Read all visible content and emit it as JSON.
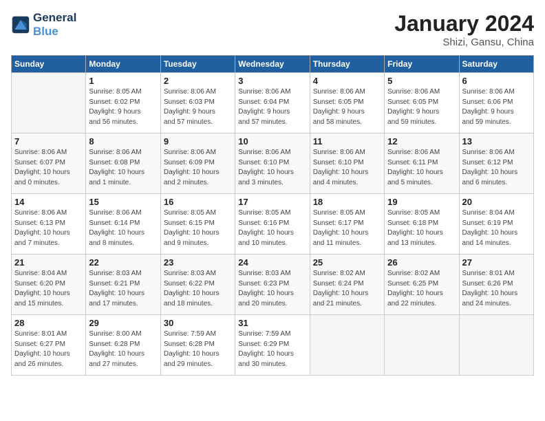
{
  "header": {
    "logo_general": "General",
    "logo_blue": "Blue",
    "month_title": "January 2024",
    "location": "Shizi, Gansu, China"
  },
  "weekdays": [
    "Sunday",
    "Monday",
    "Tuesday",
    "Wednesday",
    "Thursday",
    "Friday",
    "Saturday"
  ],
  "weeks": [
    [
      {
        "day": "",
        "info": ""
      },
      {
        "day": "1",
        "info": "Sunrise: 8:05 AM\nSunset: 6:02 PM\nDaylight: 9 hours\nand 56 minutes."
      },
      {
        "day": "2",
        "info": "Sunrise: 8:06 AM\nSunset: 6:03 PM\nDaylight: 9 hours\nand 57 minutes."
      },
      {
        "day": "3",
        "info": "Sunrise: 8:06 AM\nSunset: 6:04 PM\nDaylight: 9 hours\nand 57 minutes."
      },
      {
        "day": "4",
        "info": "Sunrise: 8:06 AM\nSunset: 6:05 PM\nDaylight: 9 hours\nand 58 minutes."
      },
      {
        "day": "5",
        "info": "Sunrise: 8:06 AM\nSunset: 6:05 PM\nDaylight: 9 hours\nand 59 minutes."
      },
      {
        "day": "6",
        "info": "Sunrise: 8:06 AM\nSunset: 6:06 PM\nDaylight: 9 hours\nand 59 minutes."
      }
    ],
    [
      {
        "day": "7",
        "info": "Sunrise: 8:06 AM\nSunset: 6:07 PM\nDaylight: 10 hours\nand 0 minutes."
      },
      {
        "day": "8",
        "info": "Sunrise: 8:06 AM\nSunset: 6:08 PM\nDaylight: 10 hours\nand 1 minute."
      },
      {
        "day": "9",
        "info": "Sunrise: 8:06 AM\nSunset: 6:09 PM\nDaylight: 10 hours\nand 2 minutes."
      },
      {
        "day": "10",
        "info": "Sunrise: 8:06 AM\nSunset: 6:10 PM\nDaylight: 10 hours\nand 3 minutes."
      },
      {
        "day": "11",
        "info": "Sunrise: 8:06 AM\nSunset: 6:10 PM\nDaylight: 10 hours\nand 4 minutes."
      },
      {
        "day": "12",
        "info": "Sunrise: 8:06 AM\nSunset: 6:11 PM\nDaylight: 10 hours\nand 5 minutes."
      },
      {
        "day": "13",
        "info": "Sunrise: 8:06 AM\nSunset: 6:12 PM\nDaylight: 10 hours\nand 6 minutes."
      }
    ],
    [
      {
        "day": "14",
        "info": "Sunrise: 8:06 AM\nSunset: 6:13 PM\nDaylight: 10 hours\nand 7 minutes."
      },
      {
        "day": "15",
        "info": "Sunrise: 8:06 AM\nSunset: 6:14 PM\nDaylight: 10 hours\nand 8 minutes."
      },
      {
        "day": "16",
        "info": "Sunrise: 8:05 AM\nSunset: 6:15 PM\nDaylight: 10 hours\nand 9 minutes."
      },
      {
        "day": "17",
        "info": "Sunrise: 8:05 AM\nSunset: 6:16 PM\nDaylight: 10 hours\nand 10 minutes."
      },
      {
        "day": "18",
        "info": "Sunrise: 8:05 AM\nSunset: 6:17 PM\nDaylight: 10 hours\nand 11 minutes."
      },
      {
        "day": "19",
        "info": "Sunrise: 8:05 AM\nSunset: 6:18 PM\nDaylight: 10 hours\nand 13 minutes."
      },
      {
        "day": "20",
        "info": "Sunrise: 8:04 AM\nSunset: 6:19 PM\nDaylight: 10 hours\nand 14 minutes."
      }
    ],
    [
      {
        "day": "21",
        "info": "Sunrise: 8:04 AM\nSunset: 6:20 PM\nDaylight: 10 hours\nand 15 minutes."
      },
      {
        "day": "22",
        "info": "Sunrise: 8:03 AM\nSunset: 6:21 PM\nDaylight: 10 hours\nand 17 minutes."
      },
      {
        "day": "23",
        "info": "Sunrise: 8:03 AM\nSunset: 6:22 PM\nDaylight: 10 hours\nand 18 minutes."
      },
      {
        "day": "24",
        "info": "Sunrise: 8:03 AM\nSunset: 6:23 PM\nDaylight: 10 hours\nand 20 minutes."
      },
      {
        "day": "25",
        "info": "Sunrise: 8:02 AM\nSunset: 6:24 PM\nDaylight: 10 hours\nand 21 minutes."
      },
      {
        "day": "26",
        "info": "Sunrise: 8:02 AM\nSunset: 6:25 PM\nDaylight: 10 hours\nand 22 minutes."
      },
      {
        "day": "27",
        "info": "Sunrise: 8:01 AM\nSunset: 6:26 PM\nDaylight: 10 hours\nand 24 minutes."
      }
    ],
    [
      {
        "day": "28",
        "info": "Sunrise: 8:01 AM\nSunset: 6:27 PM\nDaylight: 10 hours\nand 26 minutes."
      },
      {
        "day": "29",
        "info": "Sunrise: 8:00 AM\nSunset: 6:28 PM\nDaylight: 10 hours\nand 27 minutes."
      },
      {
        "day": "30",
        "info": "Sunrise: 7:59 AM\nSunset: 6:28 PM\nDaylight: 10 hours\nand 29 minutes."
      },
      {
        "day": "31",
        "info": "Sunrise: 7:59 AM\nSunset: 6:29 PM\nDaylight: 10 hours\nand 30 minutes."
      },
      {
        "day": "",
        "info": ""
      },
      {
        "day": "",
        "info": ""
      },
      {
        "day": "",
        "info": ""
      }
    ]
  ]
}
